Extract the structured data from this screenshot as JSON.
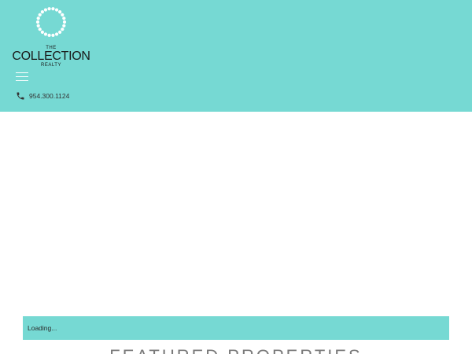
{
  "header": {
    "background": "#76d9d3",
    "logo": {
      "the": "THE",
      "main": "COLLECTION",
      "realty": "REALTY",
      "icon": "pearl-ring-icon"
    },
    "menu_icon": "hamburger-menu-icon",
    "phone": {
      "icon": "phone-icon",
      "number": "954.300.1124"
    }
  },
  "loading": {
    "text": "Loading...",
    "background": "#76d9d3"
  },
  "featured": {
    "title": "FEATURED PROPERTIES"
  }
}
